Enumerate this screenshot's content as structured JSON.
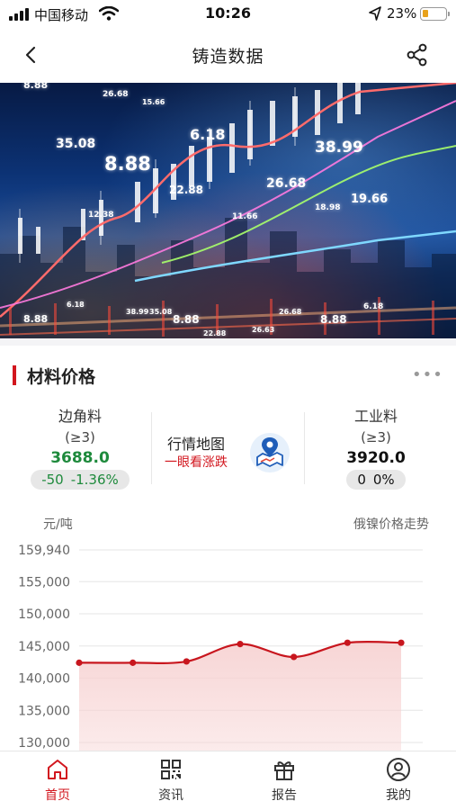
{
  "status_bar": {
    "carrier": "中国移动",
    "time": "10:26",
    "battery": "23%"
  },
  "nav": {
    "title": "铸造数据"
  },
  "banner": {
    "numbers": [
      "8.88",
      "26.68",
      "15.66",
      "35.08",
      "8.88",
      "6.18",
      "22.88",
      "26.68",
      "38.99",
      "19.66",
      "18.98",
      "11.66",
      "12.38",
      "8.88",
      "6.18",
      "38.99",
      "26.63",
      "35.08",
      "8.88",
      "6.18",
      "26.68",
      "8.88",
      "22.88"
    ]
  },
  "material_price": {
    "title": "材料价格",
    "more": "•••",
    "items": [
      {
        "name": "边角料",
        "grade": "(≥3)",
        "price": "3688.0",
        "change": "-50",
        "change_pct": "-1.36%",
        "color": "#1e8a3c"
      },
      {
        "name": "工业料",
        "grade": "(≥3)",
        "price": "3920.0",
        "change": "0",
        "change_pct": "0%",
        "color": "#111111"
      }
    ],
    "market_map": {
      "title": "行情地图",
      "subtitle": "一眼看涨跌",
      "icon": "map-pin-icon"
    }
  },
  "chart_data": {
    "type": "area",
    "title": "俄镍价格走势",
    "ylabel": "元/吨",
    "y_ticks": [
      "159,940",
      "155,000",
      "150,000",
      "145,000",
      "140,000",
      "135,000",
      "130,000"
    ],
    "ylim": [
      130000,
      159940
    ],
    "grid": true,
    "series": [
      {
        "values": [
          142400,
          142400,
          142600,
          145300,
          143300,
          145500,
          145500
        ]
      }
    ],
    "line_color": "#c8161e",
    "fill_color": "#f7d3d3"
  },
  "tabbar": {
    "tabs": [
      {
        "label": "首页",
        "icon": "home-icon",
        "active": true
      },
      {
        "label": "资讯",
        "icon": "qrcode-icon",
        "active": false
      },
      {
        "label": "报告",
        "icon": "gift-icon",
        "active": false
      },
      {
        "label": "我的",
        "icon": "user-icon",
        "active": false
      }
    ]
  }
}
